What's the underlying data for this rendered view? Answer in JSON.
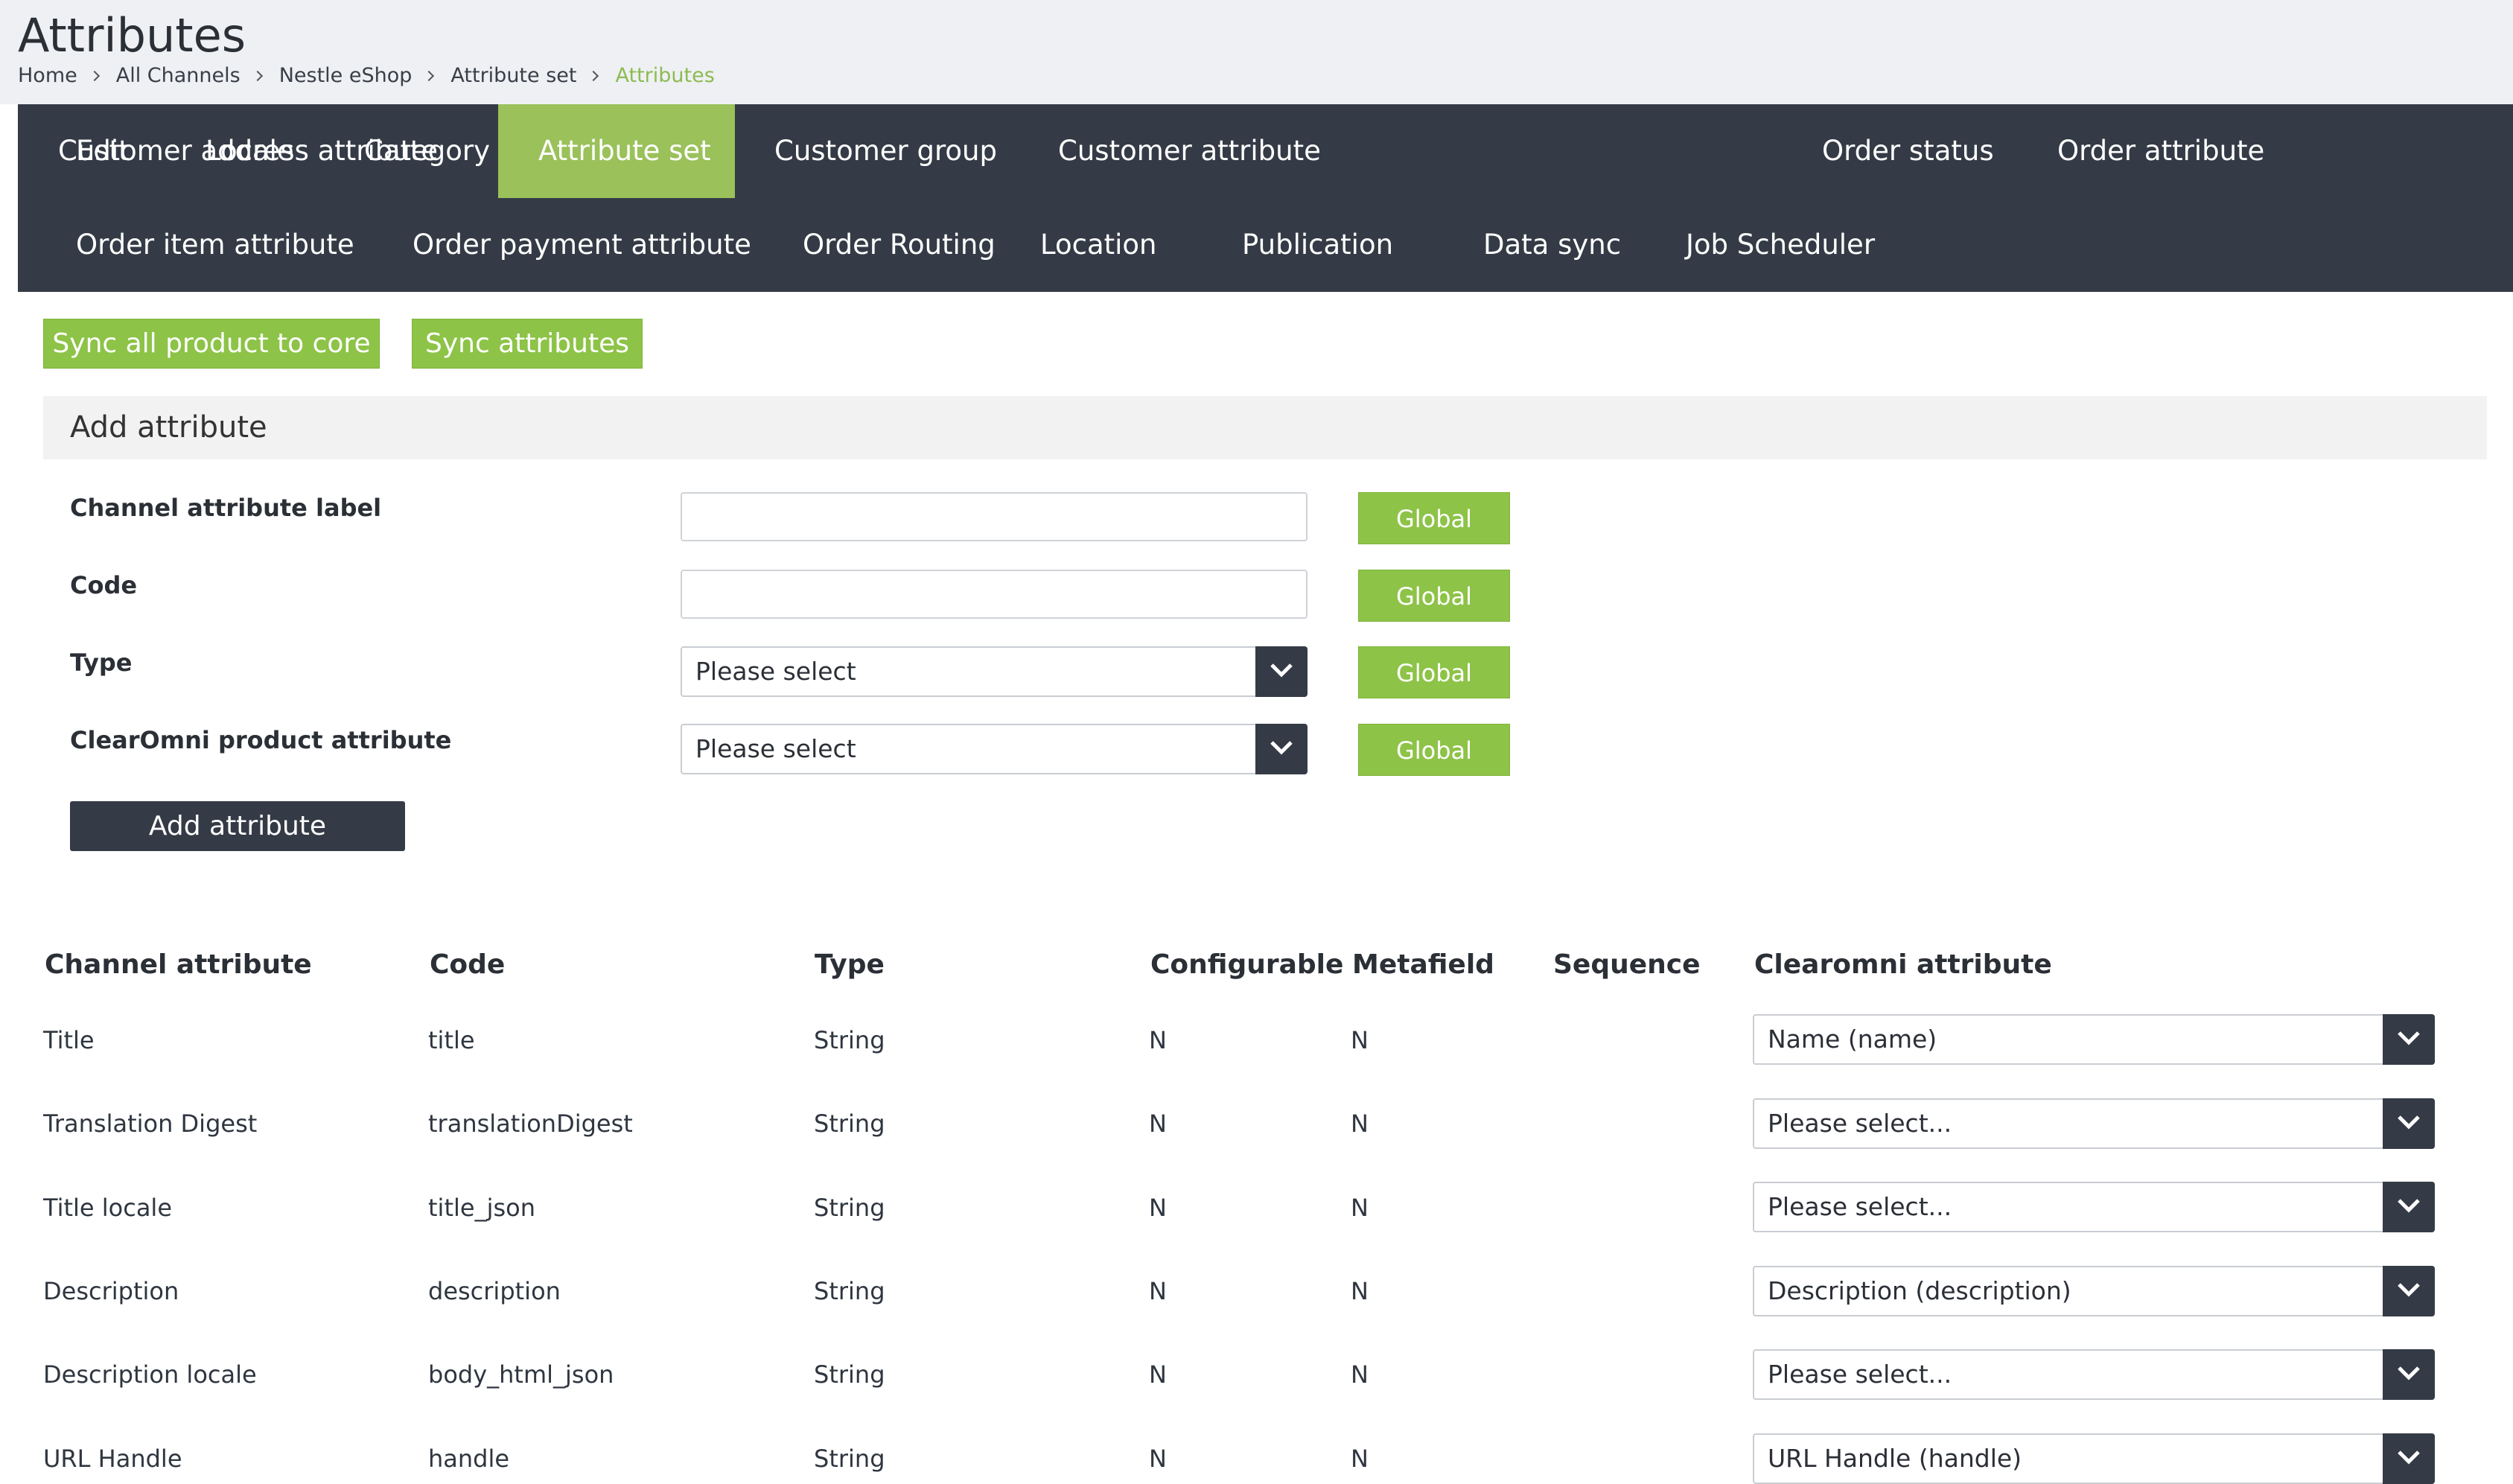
{
  "page": {
    "title": "Attributes",
    "breadcrumb": [
      "Home",
      "All Channels",
      "Nestle eShop",
      "Attribute set",
      "Attributes"
    ]
  },
  "tabs": {
    "row1": [
      "Edit",
      "Locale",
      "Category",
      "Attribute set",
      "Customer group",
      "Customer attribute",
      "Customer address attribute",
      "Order status",
      "Order attribute"
    ],
    "row2": [
      "Order item attribute",
      "Order payment attribute",
      "Order Routing",
      "Location",
      "Publication",
      "Data sync",
      "Job Scheduler"
    ],
    "active": "Attribute set"
  },
  "actions": {
    "sync_products": "Sync all product to core",
    "sync_attributes": "Sync attributes"
  },
  "add_attribute": {
    "title": "Add attribute",
    "fields": [
      {
        "label": "Channel attribute label",
        "value": "",
        "scope": "Global"
      },
      {
        "label": "Code",
        "value": "",
        "scope": "Global"
      },
      {
        "label": "Type",
        "value": "Please select",
        "scope": "Global"
      },
      {
        "label": "ClearOmni product attribute",
        "value": "Please select",
        "scope": "Global"
      }
    ],
    "submit": "Add attribute"
  },
  "table": {
    "columns": [
      "Channel attribute",
      "Code",
      "Type",
      "Configurable",
      "Metafield",
      "Sequence",
      "Clearomni attribute"
    ],
    "rows": [
      {
        "label": "Title",
        "code": "title",
        "type": "String",
        "configurable": "N",
        "metafield": "N",
        "sequence": "",
        "clearomni": "Name (name)"
      },
      {
        "label": "Translation Digest",
        "code": "translationDigest",
        "type": "String",
        "configurable": "N",
        "metafield": "N",
        "sequence": "",
        "clearomni": "Please select..."
      },
      {
        "label": "Title locale",
        "code": "title_json",
        "type": "String",
        "configurable": "N",
        "metafield": "N",
        "sequence": "",
        "clearomni": "Please select..."
      },
      {
        "label": "Description",
        "code": "description",
        "type": "String",
        "configurable": "N",
        "metafield": "N",
        "sequence": "",
        "clearomni": "Description (description)"
      },
      {
        "label": "Description locale",
        "code": "body_html_json",
        "type": "String",
        "configurable": "N",
        "metafield": "N",
        "sequence": "",
        "clearomni": "Please select..."
      },
      {
        "label": "URL Handle",
        "code": "handle",
        "type": "String",
        "configurable": "N",
        "metafield": "N",
        "sequence": "",
        "clearomni": "URL Handle (handle)"
      }
    ]
  },
  "colors": {
    "nav_bg": "#343b46",
    "accent_green": "#8dc347",
    "active_tab": "#9ac15a",
    "breadcrumb_current": "#8dbb4f",
    "header_bg": "#eef0f4"
  },
  "icons": {
    "breadcrumb_separator": "chevron-right-icon",
    "select_arrow": "chevron-down-icon"
  }
}
